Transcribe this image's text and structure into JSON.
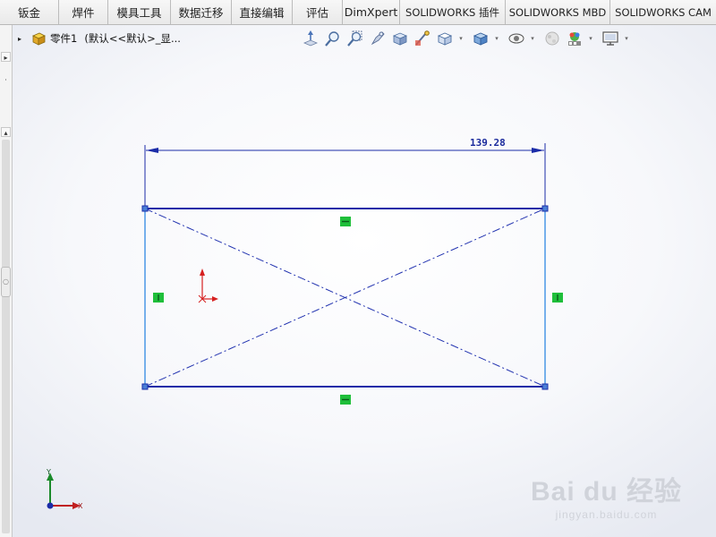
{
  "tabs": [
    "钣金",
    "焊件",
    "模具工具",
    "数据迁移",
    "直接编辑",
    "评估",
    "DimXpert",
    "SOLIDWORKS 插件",
    "SOLIDWORKS MBD",
    "SOLIDWORKS CAM"
  ],
  "tree": {
    "expand_glyph": "▸",
    "part_name": "零件1",
    "config_label": "(默认<<默认>_显..."
  },
  "heads_up_toolbar": [
    {
      "icon": "normal-to-icon",
      "has_dropdown": false
    },
    {
      "icon": "zoom-to-fit-icon",
      "has_dropdown": false
    },
    {
      "icon": "zoom-to-area-icon",
      "has_dropdown": false
    },
    {
      "icon": "previous-view-icon",
      "has_dropdown": false
    },
    {
      "icon": "section-view-icon",
      "has_dropdown": false
    },
    {
      "icon": "dynamic-annotation-icon",
      "has_dropdown": false
    },
    {
      "icon": "view-orientation-icon",
      "has_dropdown": true
    },
    {
      "icon": "display-style-icon",
      "has_dropdown": true
    },
    {
      "icon": "hide-show-items-icon",
      "has_dropdown": true
    },
    {
      "icon": "edit-appearance-icon",
      "has_dropdown": false
    },
    {
      "icon": "apply-scene-icon",
      "has_dropdown": true
    },
    {
      "icon": "view-settings-icon",
      "has_dropdown": true
    }
  ],
  "sketch": {
    "dimension_value": "139.28",
    "colors": {
      "defined_line": "#1b2ca8",
      "selected_line": "#4a97e6",
      "construction": "#2233b0",
      "relation": "#1fbf3a",
      "origin": "#d62020"
    }
  },
  "triad": {
    "x_label": "X",
    "y_label": "Y"
  },
  "watermark": {
    "main": "Bai du 经验",
    "sub": "jingyan.baidu.com"
  }
}
